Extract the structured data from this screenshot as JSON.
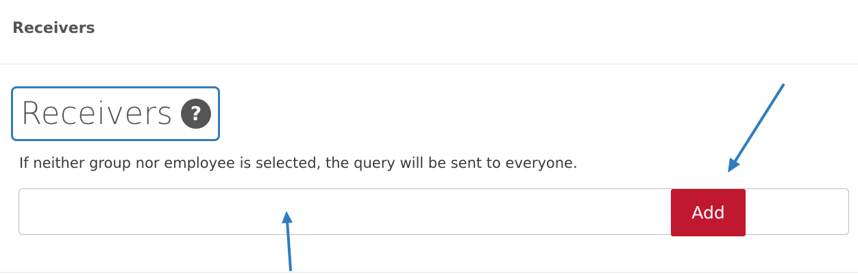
{
  "panel": {
    "title": "Receivers"
  },
  "receivers": {
    "heading": "Receivers",
    "help_icon": "question-circle-icon",
    "help_glyph": "?",
    "hint": "If neither group nor employee is selected, the query will be sent to everyone.",
    "input_value": "",
    "input_placeholder": "",
    "add_label": "Add"
  },
  "colors": {
    "accent_button": "#c0182f",
    "highlight_box": "#2e7dc0",
    "annotation_arrow": "#2e7dc0"
  }
}
